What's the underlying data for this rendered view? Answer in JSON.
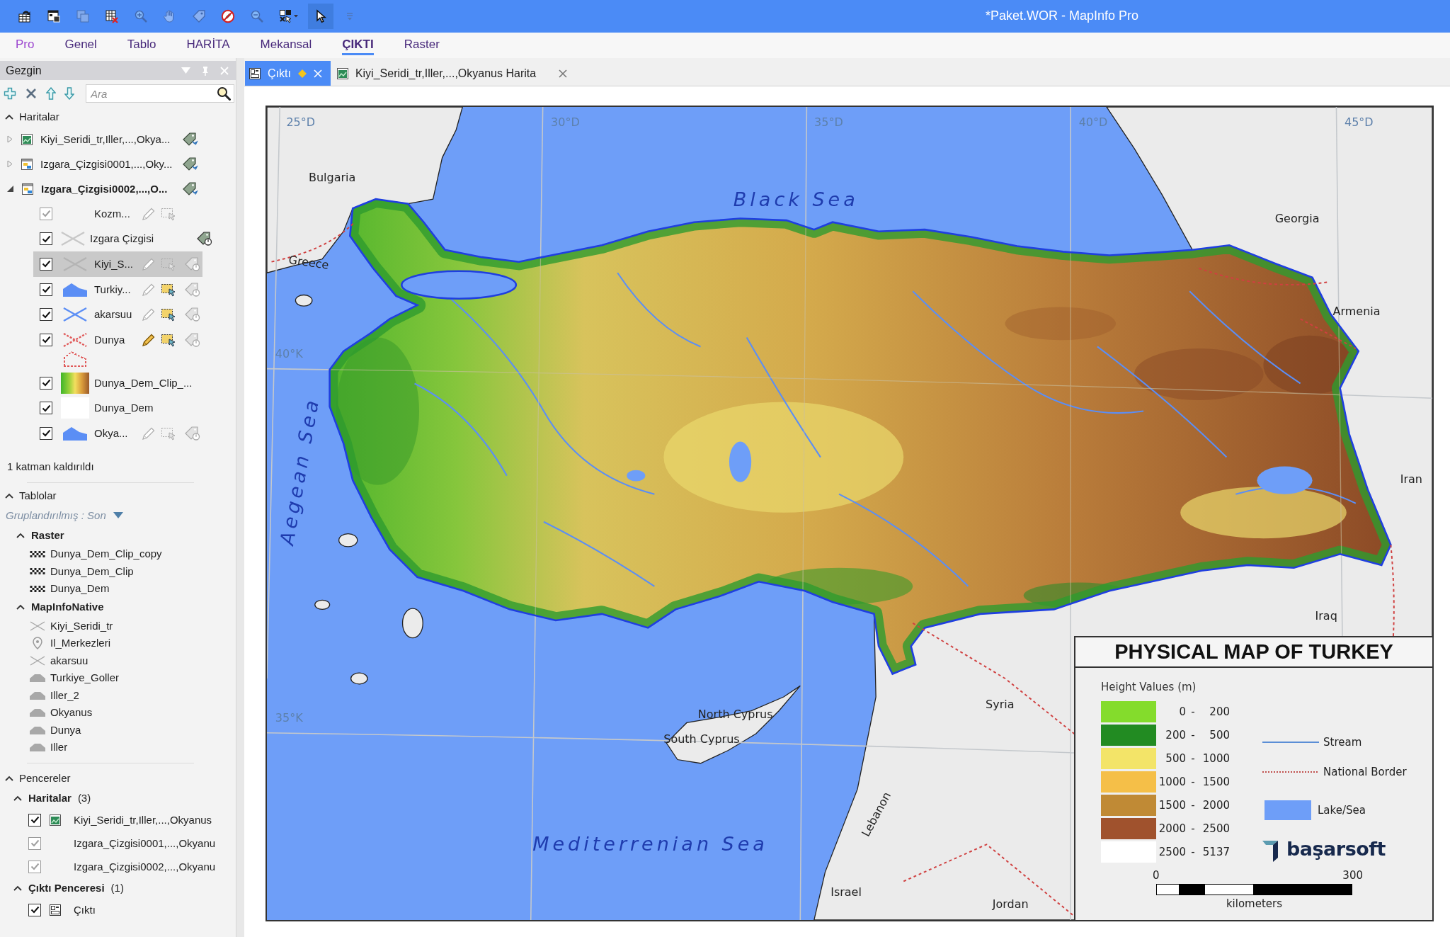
{
  "window": {
    "title": "*Paket.WOR - MapInfo Pro"
  },
  "quick_access_toolbar": [
    {
      "disabled": false,
      "selected": false
    },
    {
      "disabled": false,
      "selected": false
    },
    {
      "disabled": true,
      "selected": false
    },
    {
      "disabled": false,
      "selected": false
    },
    {
      "disabled": true,
      "selected": false
    },
    {
      "disabled": true,
      "selected": false
    },
    {
      "disabled": true,
      "selected": false
    },
    {
      "disabled": false,
      "selected": false
    },
    {
      "disabled": true,
      "selected": false
    },
    {
      "disabled": false,
      "selected": false
    },
    {
      "disabled": false,
      "selected": true
    },
    {
      "disabled": true,
      "selected": false
    }
  ],
  "ribbon_tabs": [
    {
      "label": "Pro",
      "kind": "backstage",
      "selected": false
    },
    {
      "label": "Genel",
      "kind": "tab",
      "selected": false
    },
    {
      "label": "Tablo",
      "kind": "tab",
      "selected": false
    },
    {
      "label": "HARİTA",
      "kind": "tab",
      "selected": false
    },
    {
      "label": "Mekansal",
      "kind": "tab",
      "selected": false
    },
    {
      "label": "ÇIKTI",
      "kind": "tab",
      "selected": true
    },
    {
      "label": "Raster",
      "kind": "tab",
      "selected": false
    }
  ],
  "explorer": {
    "title": "Gezgin",
    "search": {
      "placeholder": "Ara"
    },
    "maps": {
      "label": "Haritalar",
      "expanded": true,
      "items": [
        {
          "name": "Kiyi_Seridi_tr,Iller,...,Okya...",
          "kind": "map",
          "expanded": false,
          "selected": false
        },
        {
          "name": "Izgara_Çizgisi0001,...,Oky...",
          "kind": "map-window",
          "expanded": false,
          "selected": false
        },
        {
          "name": "Izgara_Çizgisi0002,...,O...",
          "kind": "map-window",
          "expanded": true,
          "selected": true,
          "layers": [
            {
              "name": "Kozm...",
              "checked": true,
              "disabled": true,
              "selected": false,
              "tools": [
                {
                  "kind": "edit",
                  "on": false
                },
                {
                  "kind": "select",
                  "on": false
                }
              ]
            },
            {
              "name": "Izgara Çizgisi",
              "checked": true,
              "disabled": false,
              "selected": false,
              "swatch": {
                "kind": "cross",
                "color": "#c8c8c8"
              },
              "tools": [
                {
                  "kind": "labels",
                  "on": true
                }
              ]
            },
            {
              "name": "Kiyi_S...",
              "checked": true,
              "disabled": false,
              "selected": true,
              "swatch": {
                "kind": "cross",
                "color": "#b4b4b4"
              },
              "tools": [
                {
                  "kind": "edit",
                  "on": false
                },
                {
                  "kind": "select",
                  "on": false
                },
                {
                  "kind": "labels",
                  "on": false
                }
              ]
            },
            {
              "name": "Turkiy...",
              "checked": true,
              "disabled": false,
              "selected": false,
              "swatch": {
                "kind": "polygon",
                "color": "#5b8ef5"
              },
              "tools": [
                {
                  "kind": "edit",
                  "on": false
                },
                {
                  "kind": "select",
                  "on": true
                },
                {
                  "kind": "labels",
                  "on": false
                }
              ]
            },
            {
              "name": "akarsuu",
              "checked": true,
              "disabled": false,
              "selected": false,
              "swatch": {
                "kind": "cross",
                "color": "#5b8ef5"
              },
              "tools": [
                {
                  "kind": "edit",
                  "on": false
                },
                {
                  "kind": "select",
                  "on": true
                },
                {
                  "kind": "labels",
                  "on": false
                }
              ]
            },
            {
              "name": "Dunya",
              "checked": true,
              "disabled": false,
              "selected": false,
              "swatch": {
                "kind": "dotted",
                "color": "#e05a5a"
              },
              "tools": [
                {
                  "kind": "edit",
                  "on": true
                },
                {
                  "kind": "select",
                  "on": true
                },
                {
                  "kind": "labels",
                  "on": false
                }
              ]
            },
            {
              "name": "Dunya_Dem_Clip_...",
              "checked": true,
              "disabled": false,
              "selected": false,
              "swatch": {
                "kind": "ramp"
              }
            },
            {
              "name": "Dunya_Dem",
              "checked": true,
              "disabled": false,
              "selected": false,
              "swatch": {
                "kind": "blank"
              }
            },
            {
              "name": "Okya...",
              "checked": true,
              "disabled": false,
              "selected": false,
              "swatch": {
                "kind": "polygon",
                "color": "#5b8ef5"
              },
              "tools": [
                {
                  "kind": "edit",
                  "on": false
                },
                {
                  "kind": "select",
                  "on": false
                },
                {
                  "kind": "labels",
                  "on": false
                }
              ]
            }
          ]
        }
      ]
    },
    "note": "1 katman kaldırıldı",
    "tables": {
      "label": "Tablolar",
      "expanded": true,
      "grouping": "Gruplandırılmış : Son",
      "groups": [
        {
          "label": "Raster",
          "expanded": true,
          "items": [
            {
              "name": "Dunya_Dem_Clip_copy",
              "kind": "raster"
            },
            {
              "name": "Dunya_Dem_Clip",
              "kind": "raster"
            },
            {
              "name": "Dunya_Dem",
              "kind": "raster"
            }
          ]
        },
        {
          "label": "MapInfoNative",
          "expanded": true,
          "items": [
            {
              "name": "Kiyi_Seridi_tr",
              "kind": "line"
            },
            {
              "name": "Il_Merkezleri",
              "kind": "point"
            },
            {
              "name": "akarsuu",
              "kind": "line"
            },
            {
              "name": "Turkiye_Goller",
              "kind": "region"
            },
            {
              "name": "Iller_2",
              "kind": "region"
            },
            {
              "name": "Okyanus",
              "kind": "region"
            },
            {
              "name": "Dunya",
              "kind": "region"
            },
            {
              "name": "Iller",
              "kind": "region"
            }
          ]
        }
      ]
    },
    "windows": {
      "label": "Pencereler",
      "expanded": true,
      "groups": [
        {
          "label": "Haritalar",
          "count": "(3)",
          "expanded": true,
          "items": [
            {
              "name": "Kiyi_Seridi_tr,Iller,...,Okyanus",
              "kind": "map",
              "checked": true,
              "disabled": false
            },
            {
              "name": "Izgara_Çizgisi0001,...,Okyanu",
              "kind": "plain",
              "checked": true,
              "disabled": true
            },
            {
              "name": "Izgara_Çizgisi0002,...,Okyanu",
              "kind": "plain",
              "checked": true,
              "disabled": true
            }
          ]
        },
        {
          "label": "Çıktı Penceresi",
          "count": "(1)",
          "expanded": true,
          "items": [
            {
              "name": "Çıktı",
              "kind": "layout",
              "checked": true,
              "disabled": false
            }
          ]
        }
      ]
    }
  },
  "document_tabs": [
    {
      "label": "Çıktı",
      "kind": "layout",
      "selected": true,
      "modified": true
    },
    {
      "label": "Kiyi_Seridi_tr,Iller,...,Okyanus Harita",
      "kind": "map",
      "selected": false,
      "modified": false
    }
  ],
  "layout": {
    "map": {
      "labels": [
        {
          "text": "25°D",
          "kind": "graticule"
        },
        {
          "text": "30°D",
          "kind": "graticule"
        },
        {
          "text": "35°D",
          "kind": "graticule"
        },
        {
          "text": "40°D",
          "kind": "graticule"
        },
        {
          "text": "45°D",
          "kind": "graticule"
        },
        {
          "text": "40°K",
          "kind": "graticule"
        },
        {
          "text": "35°K",
          "kind": "graticule"
        },
        {
          "text": "Bulgaria",
          "kind": "country"
        },
        {
          "text": "Black Sea",
          "kind": "sea"
        },
        {
          "text": "Georgia",
          "kind": "country"
        },
        {
          "text": "Greece",
          "kind": "country"
        },
        {
          "text": "Armenia",
          "kind": "country"
        },
        {
          "text": "Aegean Sea",
          "kind": "sea"
        },
        {
          "text": "Iran",
          "kind": "country"
        },
        {
          "text": "Iraq",
          "kind": "country"
        },
        {
          "text": "Syria",
          "kind": "country"
        },
        {
          "text": "North Cyprus",
          "kind": "country"
        },
        {
          "text": "South Cyprus",
          "kind": "country"
        },
        {
          "text": "Mediterrenian Sea",
          "kind": "sea"
        },
        {
          "text": "Lebanon",
          "kind": "country"
        },
        {
          "text": "Israel",
          "kind": "country"
        },
        {
          "text": "Jordan",
          "kind": "country"
        }
      ]
    },
    "legend": {
      "title": "PHYSICAL MAP OF TURKEY",
      "heading": "Height Values (m)",
      "classes": [
        {
          "range": [
            "0",
            "-",
            "200"
          ],
          "color": "#84dc2c"
        },
        {
          "range": [
            "200",
            "-",
            "500"
          ],
          "color": "#228b22"
        },
        {
          "range": [
            "500",
            "-",
            "1000"
          ],
          "color": "#f3e468"
        },
        {
          "range": [
            "1000",
            "-",
            "1500"
          ],
          "color": "#f5bf48"
        },
        {
          "range": [
            "1500",
            "-",
            "2000"
          ],
          "color": "#c08a35"
        },
        {
          "range": [
            "2000",
            "-",
            "2500"
          ],
          "color": "#a0522d"
        },
        {
          "range": [
            "2500",
            "-",
            "5137"
          ],
          "color": "#ffffff"
        }
      ],
      "symbols": [
        {
          "kind": "line",
          "label": "Stream",
          "color": "#5b8ed6"
        },
        {
          "kind": "dotted-line",
          "label": "National Border",
          "color": "#c0504d"
        },
        {
          "kind": "fill",
          "label": "Lake/Sea",
          "color": "#6e9ef8"
        }
      ],
      "logo": "başarsoft",
      "scale_bar": {
        "start": "0",
        "end": "300",
        "unit": "kilometers"
      }
    }
  }
}
